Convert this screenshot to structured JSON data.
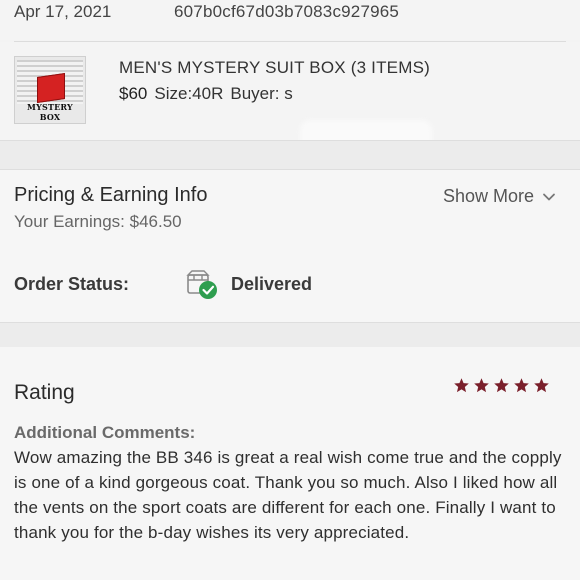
{
  "order": {
    "date": "Apr 17, 2021",
    "id": "607b0cf67d03b7083c927965"
  },
  "item": {
    "title": "MEN'S MYSTERY SUIT BOX (3 ITEMS)",
    "price": "$60",
    "size": "Size:40R",
    "buyer_label": "Buyer: s",
    "thumbnail_label": "MYSTERY BOX"
  },
  "pricing": {
    "title": "Pricing & Earning Info",
    "earnings": "Your Earnings: $46.50",
    "show_more": "Show More",
    "show_more_icon": "chevron-down-icon"
  },
  "status": {
    "label": "Order Status:",
    "value": "Delivered",
    "icon": "delivered-box-check-icon",
    "icon_color": "#2e9e4f"
  },
  "rating": {
    "title": "Rating",
    "stars": 5,
    "star_color": "#7a1f2b",
    "comments_label": "Additional Comments:",
    "comments": "Wow amazing the BB 346 is great a real wish come true and the copply is one of a kind gorgeous coat. Thank you so much. Also I liked how all the vents on the sport coats are different for each one. Finally I want to thank you for the b-day wishes its very appreciated."
  }
}
